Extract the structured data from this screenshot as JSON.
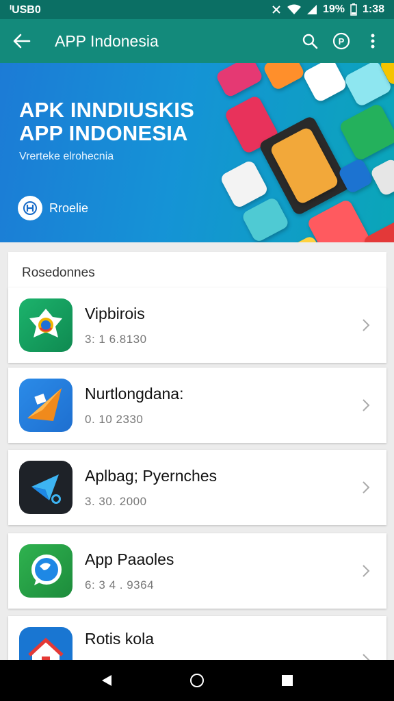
{
  "status_bar": {
    "left_text": "ᑊUSΒ0",
    "battery": "19%",
    "time": "1:38"
  },
  "app_bar": {
    "title": "APP Indonesia",
    "back_icon": "arrow-left-icon",
    "icons": [
      "search-icon",
      "help-icon",
      "more-vert-icon"
    ]
  },
  "banner": {
    "title_line1": "APK INNDIUSKIS",
    "title_line2": "APP INDONESIA",
    "subtitle": "Vrerteke elrohecnia",
    "provider_label": "Rroelie"
  },
  "section": {
    "title": "Rosedonnes"
  },
  "apps": [
    {
      "name": "Vipbirois",
      "meta": "3: 1 6.8130",
      "colors": [
        "#17a86a",
        "#0d8f55"
      ]
    },
    {
      "name": "Nurtlongdana:",
      "meta": "0. 10 2330",
      "colors": [
        "#2b8be8",
        "#f08a1c"
      ]
    },
    {
      "name": "Aplbag; Pyernches",
      "meta": "3. 30. 2000",
      "colors": [
        "#1e2228",
        "#2e3440"
      ]
    },
    {
      "name": "App Paaoles",
      "meta": "6: 3 4 . 9364",
      "colors": [
        "#25a84a",
        "#1d8c3c"
      ]
    },
    {
      "name": "Rotis kola",
      "meta": "",
      "colors": [
        "#1976d2",
        "#1e88e5"
      ]
    }
  ],
  "nav_bar": {
    "icons": [
      "back-triangle-icon",
      "home-circle-icon",
      "recents-square-icon"
    ]
  }
}
